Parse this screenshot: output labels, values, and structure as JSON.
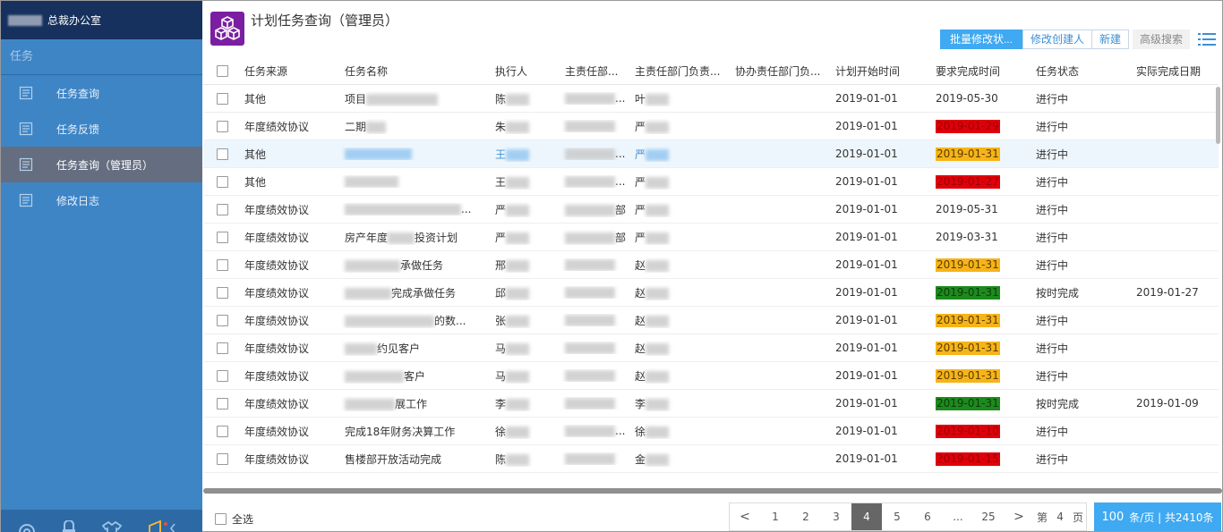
{
  "sidebar": {
    "org_name": "总裁办公室",
    "section": "任务",
    "items": [
      {
        "label": "任务查询",
        "active": false
      },
      {
        "label": "任务反馈",
        "active": false
      },
      {
        "label": "任务查询（管理员）",
        "active": true
      },
      {
        "label": "修改日志",
        "active": false
      }
    ]
  },
  "header": {
    "title": "计划任务查询（管理员）",
    "toolbar": {
      "batch_status": "批量修改状...",
      "edit_creator": "修改创建人",
      "new": "新建",
      "advanced_search": "高级搜索"
    }
  },
  "grid": {
    "columns": [
      "任务来源",
      "任务名称",
      "执行人",
      "主责任部...",
      "主责任部门负责...",
      "协办责任部门负...",
      "计划开始时间",
      "要求完成时间",
      "任务状态",
      "实际完成日期"
    ],
    "rows": [
      {
        "source": "其他",
        "name_prefix": "项目",
        "name_suffix": "",
        "exec": "陈",
        "dept": "",
        "dept_suffix": "...",
        "lead": "叶",
        "start": "2019-01-01",
        "due": "2019-05-30",
        "due_color": "",
        "status": "进行中",
        "actual": ""
      },
      {
        "source": "年度绩效协议",
        "name_prefix": "二期",
        "name_suffix": "",
        "exec": "朱",
        "dept": "",
        "dept_suffix": "",
        "lead": "严",
        "start": "2019-01-01",
        "due": "2019-01-29",
        "due_color": "red",
        "status": "进行中",
        "actual": ""
      },
      {
        "source": "其他",
        "name_prefix": "",
        "name_suffix": "",
        "exec": "王",
        "dept": "",
        "dept_suffix": "...",
        "lead": "严",
        "start": "2019-01-01",
        "due": "2019-01-31",
        "due_color": "yellow",
        "status": "进行中",
        "actual": "",
        "highlight": true
      },
      {
        "source": "其他",
        "name_prefix": "",
        "name_suffix": "",
        "exec": "王",
        "dept": "",
        "dept_suffix": "...",
        "lead": "严",
        "start": "2019-01-01",
        "due": "2019-01-27",
        "due_color": "red",
        "status": "进行中",
        "actual": ""
      },
      {
        "source": "年度绩效协议",
        "name_prefix": "",
        "name_suffix": "...",
        "exec": "严",
        "dept": "",
        "dept_suffix": "部",
        "lead": "严",
        "start": "2019-01-01",
        "due": "2019-05-31",
        "due_color": "",
        "status": "进行中",
        "actual": ""
      },
      {
        "source": "年度绩效协议",
        "name_prefix": "房产年度",
        "name_suffix": "投资计划",
        "exec": "严",
        "dept": "",
        "dept_suffix": "部",
        "lead": "严",
        "start": "2019-01-01",
        "due": "2019-03-31",
        "due_color": "",
        "status": "进行中",
        "actual": ""
      },
      {
        "source": "年度绩效协议",
        "name_prefix": "",
        "name_suffix": "承做任务",
        "exec": "邢",
        "dept": "",
        "dept_suffix": "",
        "lead": "赵",
        "start": "2019-01-01",
        "due": "2019-01-31",
        "due_color": "yellow",
        "status": "进行中",
        "actual": ""
      },
      {
        "source": "年度绩效协议",
        "name_prefix": "",
        "name_suffix": "完成承做任务",
        "exec": "邱",
        "dept": "",
        "dept_suffix": "",
        "lead": "赵",
        "start": "2019-01-01",
        "due": "2019-01-31",
        "due_color": "green",
        "status": "按时完成",
        "actual": "2019-01-27"
      },
      {
        "source": "年度绩效协议",
        "name_prefix": "",
        "name_suffix": "的数...",
        "exec": "张",
        "dept": "",
        "dept_suffix": "",
        "lead": "赵",
        "start": "2019-01-01",
        "due": "2019-01-31",
        "due_color": "yellow",
        "status": "进行中",
        "actual": ""
      },
      {
        "source": "年度绩效协议",
        "name_prefix": "",
        "name_suffix": "约见客户",
        "exec": "马",
        "dept": "",
        "dept_suffix": "",
        "lead": "赵",
        "start": "2019-01-01",
        "due": "2019-01-31",
        "due_color": "yellow",
        "status": "进行中",
        "actual": ""
      },
      {
        "source": "年度绩效协议",
        "name_prefix": "",
        "name_suffix": "客户",
        "exec": "马",
        "dept": "",
        "dept_suffix": "",
        "lead": "赵",
        "start": "2019-01-01",
        "due": "2019-01-31",
        "due_color": "yellow",
        "status": "进行中",
        "actual": ""
      },
      {
        "source": "年度绩效协议",
        "name_prefix": "",
        "name_suffix": "展工作",
        "exec": "李",
        "dept": "",
        "dept_suffix": "",
        "lead": "李",
        "start": "2019-01-01",
        "due": "2019-01-31",
        "due_color": "green",
        "status": "按时完成",
        "actual": "2019-01-09"
      },
      {
        "source": "年度绩效协议",
        "name_prefix": "完成18年财务决算工作",
        "name_suffix": "",
        "exec": "徐",
        "dept": "",
        "dept_suffix": "...",
        "lead": "徐",
        "start": "2019-01-01",
        "due": "2019-01-10",
        "due_color": "red",
        "status": "进行中",
        "actual": ""
      },
      {
        "source": "年度绩效协议",
        "name_prefix": "售楼部开放活动完成",
        "name_suffix": "",
        "exec": "陈",
        "dept": "",
        "dept_suffix": "",
        "lead": "金",
        "start": "2019-01-01",
        "due": "2019-01-15",
        "due_color": "red",
        "status": "进行中",
        "actual": ""
      }
    ]
  },
  "footer": {
    "select_all": "全选",
    "pages": [
      "1",
      "2",
      "3",
      "4",
      "5",
      "6",
      "...",
      "25"
    ],
    "current_page": "4",
    "prev": "<",
    "next": ">",
    "goto_prefix": "第",
    "goto_value": "4",
    "goto_suffix": "页",
    "page_size": "100",
    "page_size_suffix": "条/页 | 共2410条"
  },
  "colors": {
    "sidebar_bg": "#3e85c6",
    "sidebar_header": "#16315e",
    "active_item": "#656e80",
    "accent": "#3fa9f2",
    "logo": "#7b1fa2",
    "overdue_red": "#e0000a",
    "warn_yellow": "#f6b418",
    "done_green": "#1d8a1d"
  }
}
